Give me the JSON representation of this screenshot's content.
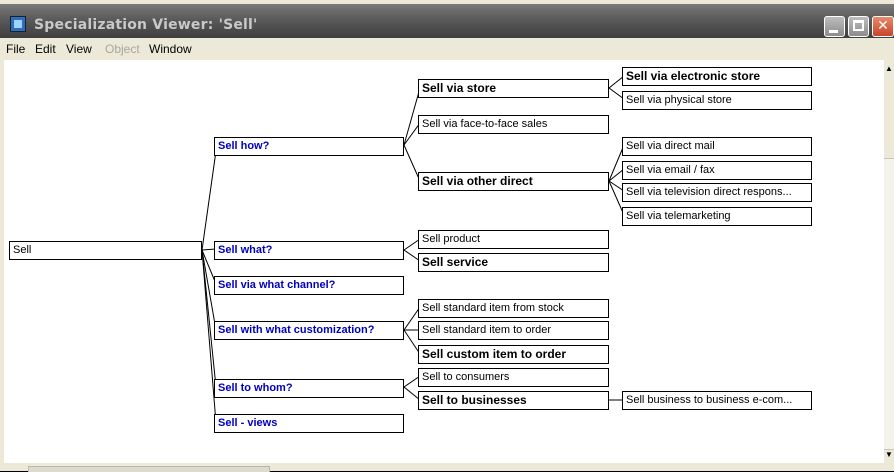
{
  "window": {
    "title": "Specialization Viewer: 'Sell'"
  },
  "menu": [
    "File",
    "Edit",
    "View",
    "Object",
    "Window"
  ],
  "tree": {
    "root": "Sell",
    "questions": {
      "how": "Sell how?",
      "what": "Sell what?",
      "channel": "Sell via what channel?",
      "customization": "Sell with what customization?",
      "whom": "Sell to whom?",
      "views": "Sell - views"
    },
    "how": {
      "store": "Sell via store",
      "face": "Sell via face-to-face sales",
      "other": "Sell via other direct"
    },
    "store": {
      "electronic": "Sell via electronic store",
      "physical": "Sell via physical store"
    },
    "other": {
      "mail": "Sell via direct mail",
      "email": "Sell via email / fax",
      "tv": "Sell via television direct respons...",
      "tele": "Sell via telemarketing"
    },
    "what": {
      "product": "Sell product",
      "service": "Sell service"
    },
    "customization": {
      "stock": "Sell standard item from stock",
      "order": "Sell standard item to order",
      "custom": "Sell custom item to order"
    },
    "whom": {
      "consumers": "Sell to consumers",
      "businesses": "Sell to businesses",
      "b2b": "Sell business to business e-com..."
    }
  }
}
